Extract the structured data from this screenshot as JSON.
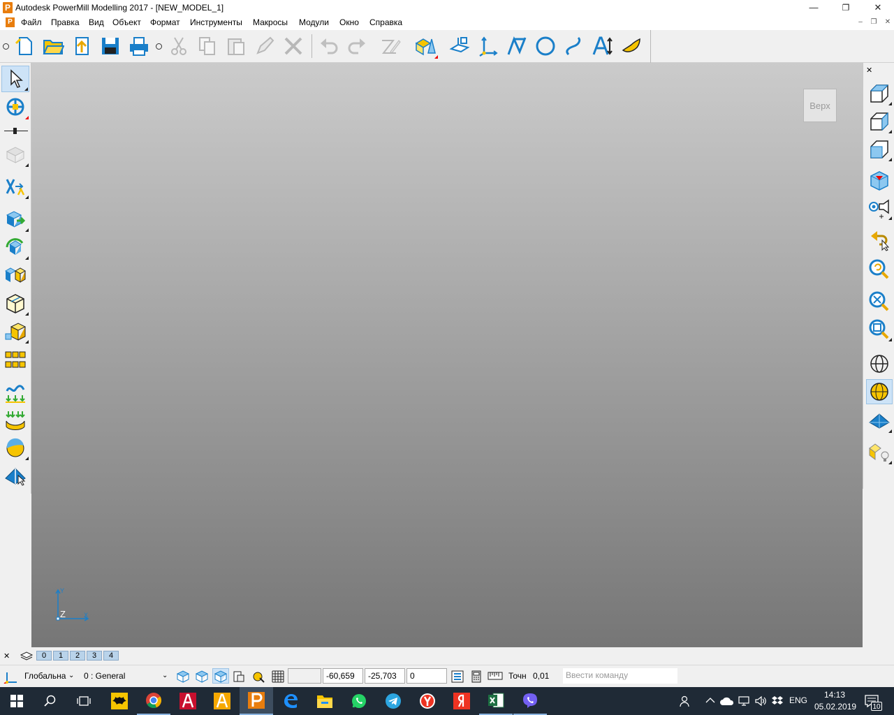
{
  "window": {
    "app_icon_letter": "P",
    "title": "Autodesk PowerMill Modelling 2017 - [NEW_MODEL_1]",
    "minimize": "—",
    "maximize": "❐",
    "close": "✕"
  },
  "menubar": {
    "items": [
      "Файл",
      "Правка",
      "Вид",
      "Объект",
      "Формат",
      "Инструменты",
      "Макросы",
      "Модули",
      "Окно",
      "Справка"
    ],
    "mdi_minimize": "–",
    "mdi_restore": "❐",
    "mdi_close": "✕"
  },
  "viewport": {
    "view_label": "Верх",
    "axis_z": "Z",
    "axis_y": "Y",
    "axis_x": "X"
  },
  "layerbar": {
    "close": "✕",
    "layers": [
      "0",
      "1",
      "2",
      "3",
      "4"
    ]
  },
  "statusbar": {
    "workplane": "Глобальна",
    "level": "0   : General",
    "blank": "",
    "coord_x": "-60,659",
    "coord_y": "-25,703",
    "coord_z": "0",
    "tolerance_label": "Точн",
    "tolerance_value": "0,01",
    "command_placeholder": "Ввести команду"
  },
  "taskbar": {
    "language": "ENG",
    "time": "14:13",
    "date": "05.02.2019",
    "notifications": "10"
  },
  "colors": {
    "accent_blue": "#1a7fc9",
    "powermill_orange": "#e87d0d",
    "viewport_top": "#cbcbcb",
    "viewport_bottom": "#767676"
  },
  "icons": {
    "toolbar": [
      "new-model-icon",
      "open-icon",
      "import-icon",
      "save-icon",
      "print-icon",
      "cut-icon",
      "copy-icon",
      "paste-icon",
      "edit-icon",
      "delete-icon",
      "undo-icon",
      "redo-icon",
      "sketch-icon",
      "surface-shading-icon",
      "workplane-icon",
      "axis-icon",
      "line-icon",
      "circle-icon",
      "curve-icon",
      "text-icon",
      "surface-icon"
    ]
  }
}
